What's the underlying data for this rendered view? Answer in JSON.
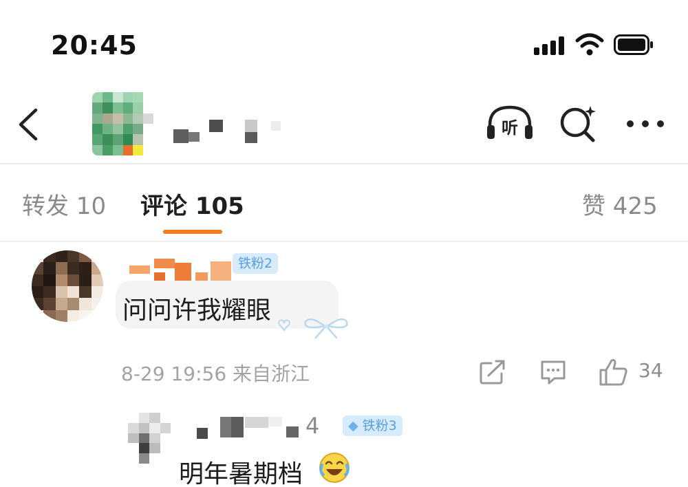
{
  "status_bar": {
    "time": "20:45"
  },
  "header": {
    "back_icon": "chevron-left-icon",
    "listen_label": "听",
    "search_icon": "ai-search-icon",
    "more_icon": "more-dots-icon"
  },
  "tabs": {
    "repost": "转发 10",
    "comments": "评论 105",
    "likes": "赞 425"
  },
  "colors": {
    "accent": "#f27c22",
    "badge_bg": "#d6ebfb",
    "badge_text": "#5a9fe0"
  },
  "comments": [
    {
      "badge": "铁粉2",
      "text": "问问许我耀眼",
      "meta": "8-29 19:56 来自浙江",
      "likes": "34"
    },
    {
      "name_suffix": "4",
      "badge": "铁粉3",
      "text": "明年暑期档",
      "emoji": "laughing-crying-emoji"
    }
  ]
}
